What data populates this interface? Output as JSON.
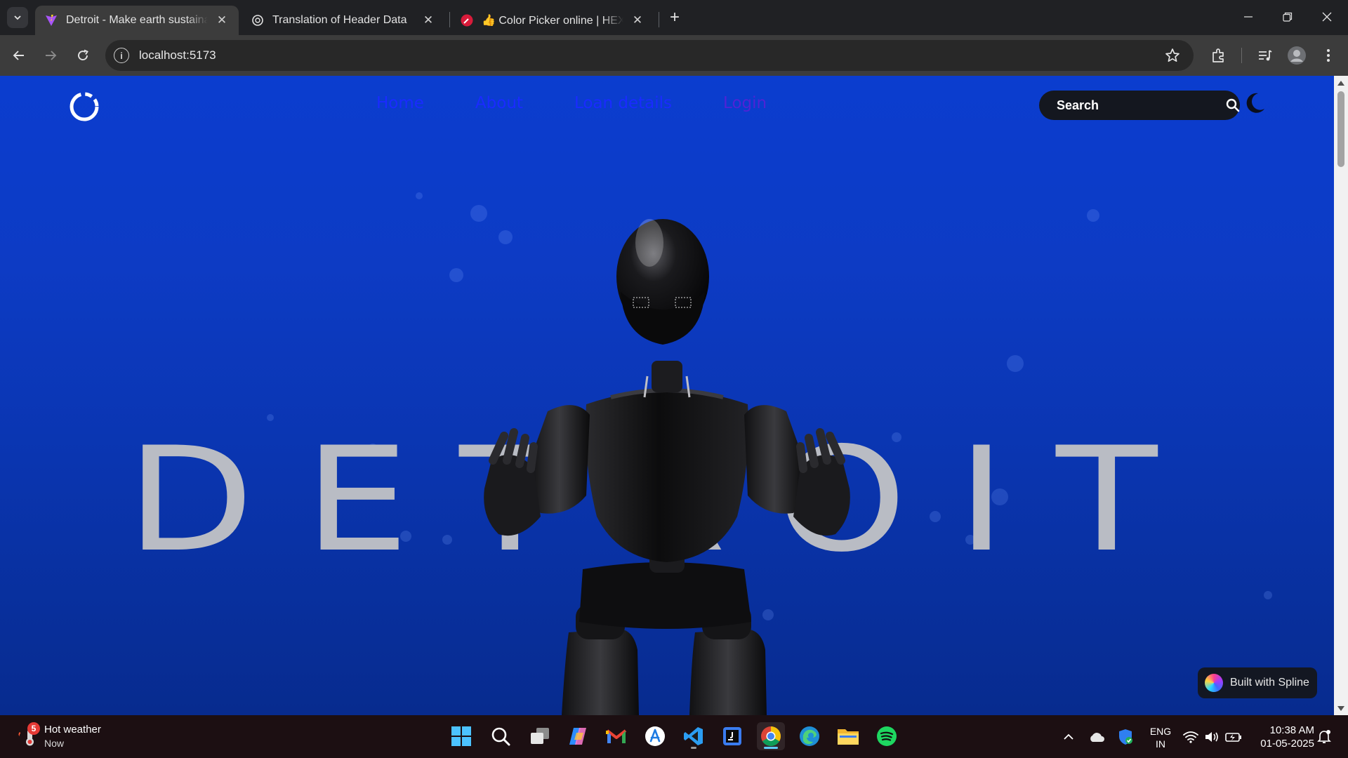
{
  "browser": {
    "tabs": [
      {
        "title": "Detroit - Make earth sustainable",
        "active": true,
        "favicon": "vite-icon"
      },
      {
        "title": "Translation of Header Data",
        "active": false,
        "favicon": "openai-icon"
      },
      {
        "title": "👍 Color Picker online | HEX Co",
        "active": false,
        "favicon": "color-picker-icon"
      }
    ],
    "url": "localhost:5173"
  },
  "site": {
    "nav": [
      "Home",
      "About",
      "Loan details",
      "Login"
    ],
    "search_placeholder": "Search",
    "hero_word": "DETROIT",
    "badge": "Built with Spline",
    "colors": {
      "background": "#0b3dcf",
      "nav_link": "#1a2bff",
      "login_link": "#4f23d6",
      "hero_text": "#b9bcc4"
    }
  },
  "taskbar": {
    "weather_title": "Hot weather",
    "weather_sub": "Now",
    "weather_badge": "5",
    "lang_line1": "ENG",
    "lang_line2": "IN",
    "time": "10:38 AM",
    "date": "01-05-2025",
    "apps": [
      "windows-start-icon",
      "search-icon",
      "task-view-icon",
      "copilot-icon",
      "gmail-icon",
      "app-store-icon",
      "vscode-icon",
      "jetbrains-icon",
      "chrome-icon",
      "edge-icon",
      "file-explorer-icon",
      "spotify-icon"
    ]
  }
}
